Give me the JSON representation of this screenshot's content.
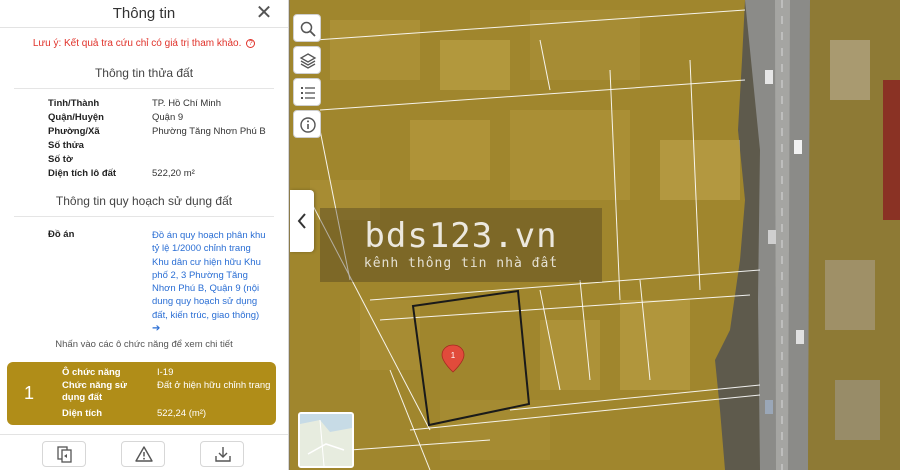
{
  "panel": {
    "title": "Thông tin",
    "close_icon": "close-icon",
    "disclaimer": "Lưu ý: Kết quả tra cứu chỉ có giá trị tham khảo.",
    "parcel_section": {
      "title": "Thông tin thửa đất",
      "rows": [
        {
          "label": "Tỉnh/Thành",
          "value": "TP. Hồ Chí Minh"
        },
        {
          "label": "Quận/Huyện",
          "value": "Quận 9"
        },
        {
          "label": "Phường/Xã",
          "value": "Phường Tăng Nhơn Phú B"
        },
        {
          "label": "Số thửa",
          "value": ""
        },
        {
          "label": "Số tờ",
          "value": ""
        },
        {
          "label": "Diện tích lô đất",
          "value": "522,20 m²"
        }
      ]
    },
    "planning_section": {
      "title": "Thông tin quy hoạch sử dụng đất",
      "label": "Đồ án",
      "link_text": "Đồ án quy hoạch phân khu tỷ lệ 1/2000 chỉnh trang Khu dân cư hiện hữu Khu phố 2, 3 Phường Tăng Nhơn Phú B, Quận 9 (nội dung quy hoạch sử dụng đất, kiến trúc, giao thông)",
      "arrow": "➔"
    },
    "hint": "Nhấn vào các ô chức năng để xem chi tiết",
    "zone_card": {
      "index": "1",
      "color": "#b08d18",
      "rows": [
        {
          "label": "Ô chức năng",
          "value": "I-19"
        },
        {
          "label": "Chức năng sử dụng đất",
          "value": "Đất ở hiện hữu chỉnh trang"
        },
        {
          "label": "Diện tích",
          "value": "522,24 (m²)"
        }
      ]
    },
    "footer_buttons": [
      {
        "name": "copy-icon"
      },
      {
        "name": "warning-icon"
      },
      {
        "name": "download-icon"
      }
    ]
  },
  "map": {
    "tools": [
      {
        "name": "search-icon"
      },
      {
        "name": "layers-icon"
      },
      {
        "name": "list-icon"
      },
      {
        "name": "info-icon"
      }
    ],
    "collapse_icon": "chevron-left-icon",
    "marker_label": "1",
    "overlay_color": "#c9a21a",
    "parcel_outline_color": "#1a1a1a",
    "watermark": {
      "logo": "bds123.vn",
      "tagline": "kênh thông tin nhà đất"
    }
  }
}
